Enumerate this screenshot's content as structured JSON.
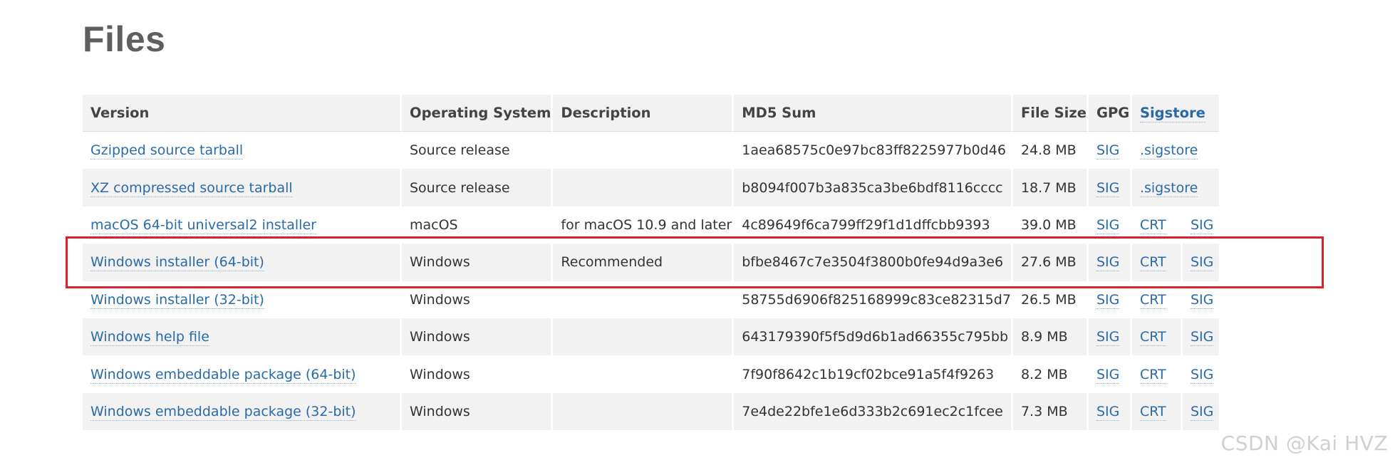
{
  "page": {
    "title": "Files",
    "watermark": "CSDN @Kai  HVZ"
  },
  "table": {
    "headers": [
      "Version",
      "Operating System",
      "Description",
      "MD5 Sum",
      "File Size",
      "GPG",
      "Sigstore"
    ],
    "rows": [
      {
        "version": "Gzipped source tarball",
        "os": "Source release",
        "description": "",
        "md5": "1aea68575c0e97bc83ff8225977b0d46",
        "size": "24.8 MB",
        "gpg": "SIG",
        "sig1": ".sigstore",
        "sig2": ""
      },
      {
        "version": "XZ compressed source tarball",
        "os": "Source release",
        "description": "",
        "md5": "b8094f007b3a835ca3be6bdf8116cccc",
        "size": "18.7 MB",
        "gpg": "SIG",
        "sig1": ".sigstore",
        "sig2": ""
      },
      {
        "version": "macOS 64-bit universal2 installer",
        "os": "macOS",
        "description": "for macOS 10.9 and later",
        "md5": "4c89649f6ca799ff29f1d1dffcbb9393",
        "size": "39.0 MB",
        "gpg": "SIG",
        "sig1": "CRT",
        "sig2": "SIG"
      },
      {
        "version": "Windows installer (64-bit)",
        "os": "Windows",
        "description": "Recommended",
        "md5": "bfbe8467c7e3504f3800b0fe94d9a3e6",
        "size": "27.6 MB",
        "gpg": "SIG",
        "sig1": "CRT",
        "sig2": "SIG"
      },
      {
        "version": "Windows installer (32-bit)",
        "os": "Windows",
        "description": "",
        "md5": "58755d6906f825168999c83ce82315d7",
        "size": "26.5 MB",
        "gpg": "SIG",
        "sig1": "CRT",
        "sig2": "SIG"
      },
      {
        "version": "Windows help file",
        "os": "Windows",
        "description": "",
        "md5": "643179390f5f5d9d6b1ad66355c795bb",
        "size": "8.9 MB",
        "gpg": "SIG",
        "sig1": "CRT",
        "sig2": "SIG"
      },
      {
        "version": "Windows embeddable package (64-bit)",
        "os": "Windows",
        "description": "",
        "md5": "7f90f8642c1b19cf02bce91a5f4f9263",
        "size": "8.2 MB",
        "gpg": "SIG",
        "sig1": "CRT",
        "sig2": "SIG"
      },
      {
        "version": "Windows embeddable package (32-bit)",
        "os": "Windows",
        "description": "",
        "md5": "7e4de22bfe1e6d333b2c691ec2c1fcee",
        "size": "7.3 MB",
        "gpg": "SIG",
        "sig1": "CRT",
        "sig2": "SIG"
      }
    ]
  },
  "colors": {
    "link": "#2b6aa8",
    "highlight": "#d8222b",
    "row_alt": "#f2f2f2",
    "title": "#5f5f5f"
  }
}
